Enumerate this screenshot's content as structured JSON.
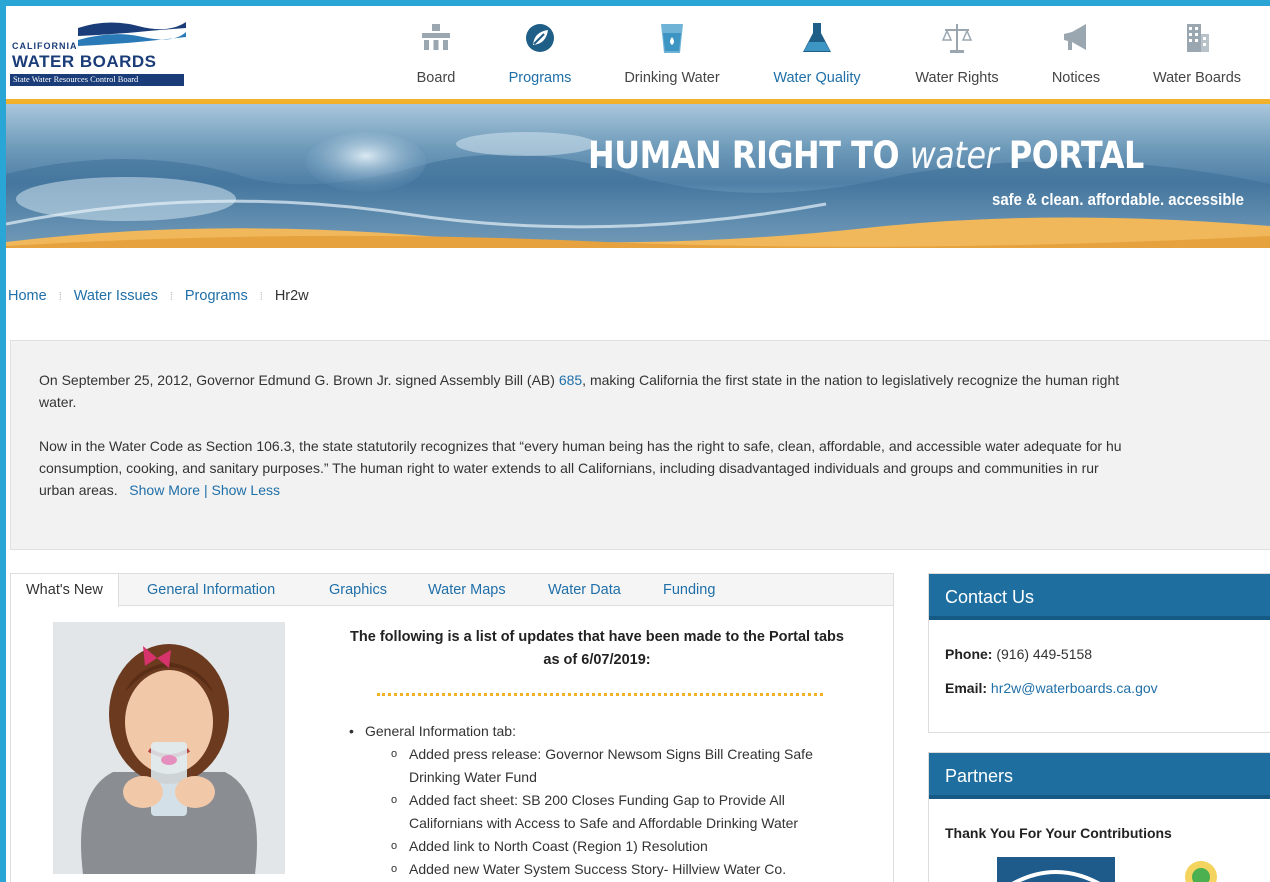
{
  "header": {
    "logo": {
      "line1": "CALIFORNIA",
      "line2": "WATER BOARDS",
      "line3": "State Water Resources Control Board"
    },
    "nav": [
      {
        "label": "Board",
        "icon": "board-icon",
        "active": false
      },
      {
        "label": "Programs",
        "icon": "leaf-icon",
        "active": true
      },
      {
        "label": "Drinking Water",
        "icon": "glass-icon",
        "active": false
      },
      {
        "label": "Water Quality",
        "icon": "flask-icon",
        "active": true
      },
      {
        "label": "Water Rights",
        "icon": "scales-icon",
        "active": false
      },
      {
        "label": "Notices",
        "icon": "megaphone-icon",
        "active": false
      },
      {
        "label": "Water Boards",
        "icon": "building-icon",
        "active": false
      }
    ],
    "accent_color": "#f2b12a",
    "brand_color": "#1a3c78"
  },
  "banner": {
    "title_bold_1": "HUMAN RIGHT TO ",
    "title_thin": "water",
    "title_bold_2": " PORTAL",
    "tagline": "safe & clean.  affordable. accessible"
  },
  "breadcrumb": [
    "Home",
    "Water Issues",
    "Programs",
    "Hr2w"
  ],
  "intro": {
    "p1_line1_a": "On September 25, 2012, Governor Edmund G. Brown Jr. signed Assembly Bill (AB) ",
    "p1_link": "685",
    "p1_line1_b": ", making California the first state in the nation to legislatively recognize the human right",
    "p1_line2": "water.",
    "p2_line1": "Now in the Water Code as Section 106.3, the state statutorily recognizes that “every human being has the right to safe, clean, affordable, and accessible water adequate for hu",
    "p2_line2": "consumption, cooking, and sanitary purposes.” The human right to water extends to all Californians, including disadvantaged individuals and groups and communities in rur",
    "p2_line3": "urban areas.",
    "show_more": "Show More",
    "separator": "|",
    "show_less": "Show Less"
  },
  "tabs": [
    {
      "label": "What's New",
      "active": true
    },
    {
      "label": "General Information",
      "active": false
    },
    {
      "label": "Graphics",
      "active": false
    },
    {
      "label": "Water Maps",
      "active": false
    },
    {
      "label": "Water Data",
      "active": false
    },
    {
      "label": "Funding",
      "active": false
    }
  ],
  "whats_new": {
    "heading_line1": "The following is a list of updates that have been made to the Portal tabs",
    "heading_line2": "as of 6/07/2019:",
    "items": [
      {
        "level": 1,
        "text": "General Information tab:"
      },
      {
        "level": 2,
        "text": "Added press release: Governor Newsom Signs Bill Creating Safe"
      },
      {
        "level": 0,
        "text": "Drinking Water Fund"
      },
      {
        "level": 2,
        "text": "Added fact sheet: SB 200 Closes Funding Gap to Provide All"
      },
      {
        "level": 0,
        "text": "Californians with Access to Safe and Affordable Drinking Water"
      },
      {
        "level": 2,
        "text": "Added link to North Coast (Region 1) Resolution"
      },
      {
        "level": 2,
        "text": "Added new Water System Success Story- Hillview Water Co."
      }
    ]
  },
  "contact": {
    "title": "Contact Us",
    "phone_label": "Phone:",
    "phone": "(916) 449-5158",
    "email_label": "Email:",
    "email": "hr2w@waterboards.ca.gov"
  },
  "partners": {
    "title": "Partners",
    "subtitle": "Thank You For Your Contributions"
  }
}
